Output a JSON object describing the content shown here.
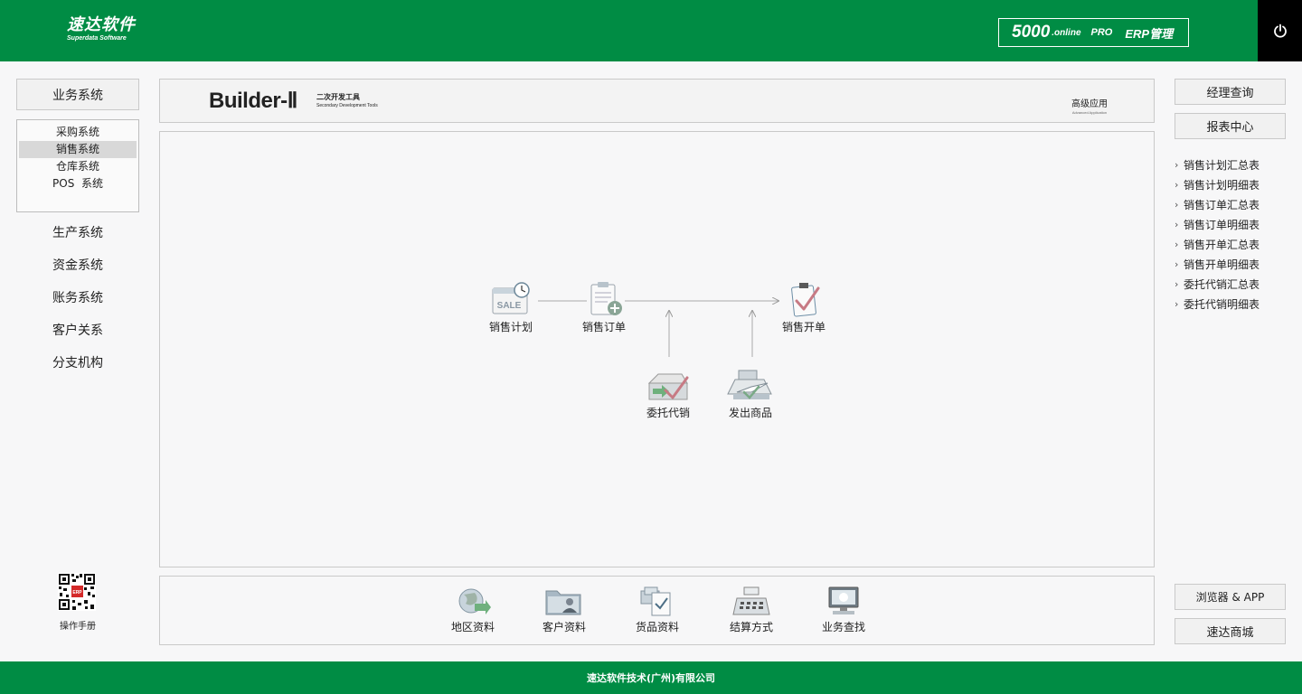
{
  "header": {
    "logo_main": "速达软件",
    "logo_sub": "Superdata Software",
    "product_num": "5000",
    "product_online": ".online",
    "product_pro": "PRO",
    "product_erp": "ERP管理",
    "power_icon": "power-icon"
  },
  "sidebar": {
    "main_button": "业务系统",
    "subsystems": [
      "采购系统",
      "销售系统",
      "仓库系统",
      "POS  系统"
    ],
    "active_subsystem": "销售系统",
    "items": [
      "生产系统",
      "资金系统",
      "账务系统",
      "客户关系",
      "分支机构"
    ],
    "manual_label": "操作手册"
  },
  "banner": {
    "title": "Builder-Ⅱ",
    "subtitle_cn": "二次开发工具",
    "subtitle_en": "Secondary Development Tools",
    "adv_cn": "高级应用",
    "adv_en": "Advanced Application"
  },
  "flow": {
    "sales_plan": "销售计划",
    "sales_order": "销售订单",
    "sales_invoice": "销售开单",
    "consignment": "委托代销",
    "ship_goods": "发出商品",
    "sale_icon_text": "SALE"
  },
  "tools": [
    "地区资料",
    "客户资料",
    "货品资料",
    "结算方式",
    "业务查找"
  ],
  "right": {
    "manager_query": "经理查询",
    "report_center": "报表中心",
    "reports": [
      "销售计划汇总表",
      "销售计划明细表",
      "销售订单汇总表",
      "销售订单明细表",
      "销售开单汇总表",
      "销售开单明细表",
      "委托代销汇总表",
      "委托代销明细表"
    ],
    "browser_app": "浏览器 & APP",
    "store": "速达商城"
  },
  "footer": {
    "company": "速达软件技术(广州)有限公司"
  },
  "colors": {
    "brand_green": "#008c44",
    "power_bg": "#000000"
  }
}
